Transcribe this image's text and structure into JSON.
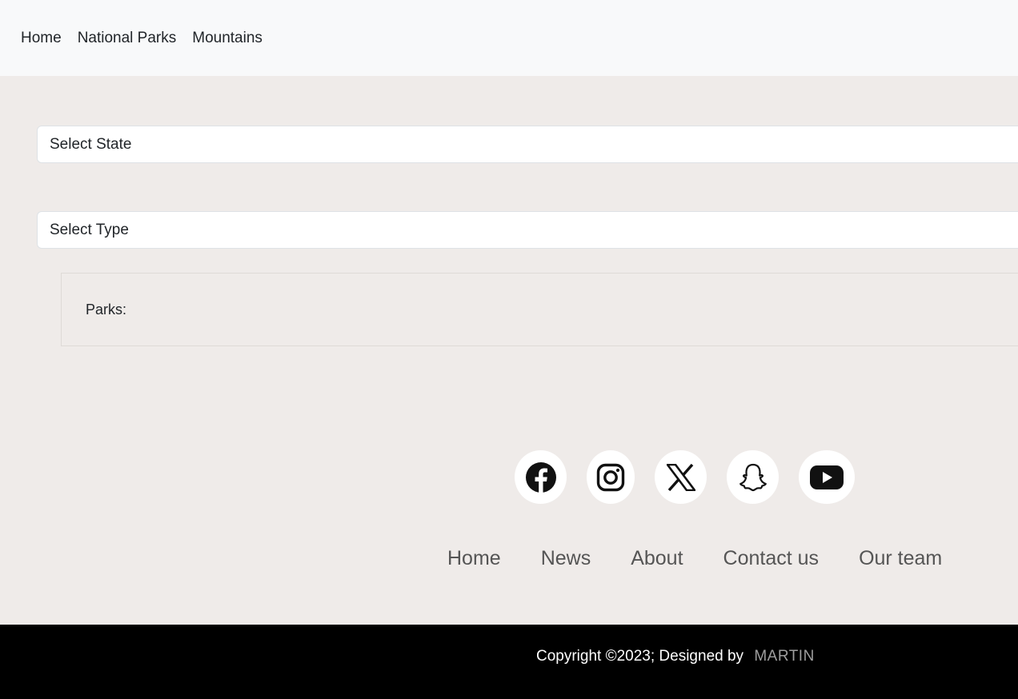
{
  "navbar": {
    "items": [
      {
        "label": "Home"
      },
      {
        "label": "National Parks"
      },
      {
        "label": "Mountains"
      }
    ]
  },
  "filters": {
    "state_label": "Select State",
    "type_label": "Select Type"
  },
  "parks": {
    "label": "Parks:"
  },
  "social": {
    "icons": [
      "facebook-icon",
      "instagram-icon",
      "x-icon",
      "snapchat-icon",
      "youtube-icon"
    ]
  },
  "footer": {
    "links": [
      {
        "label": "Home"
      },
      {
        "label": "News"
      },
      {
        "label": "About"
      },
      {
        "label": "Contact us"
      },
      {
        "label": "Our team"
      }
    ],
    "copyright": "Copyright ©2023; Designed by",
    "designer": "MARTIN"
  },
  "colors": {
    "page_background": "#efebe9",
    "navbar_background": "#f8f9fa",
    "footer_background": "#000000",
    "designer_text": "#9e9e9e"
  }
}
